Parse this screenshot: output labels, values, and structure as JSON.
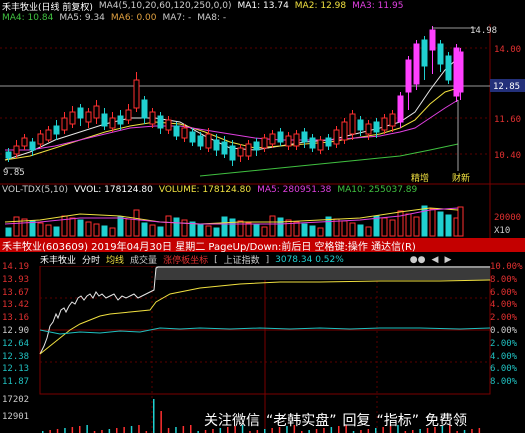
{
  "kline_header": {
    "stock_name": "禾丰牧业(日线 前复权)",
    "ma_params": "MA4(5,10,20,60,120,250,0,0)",
    "ma1": "MA1: 13.74",
    "ma2": "MA2: 12.98",
    "ma3": "MA3: 11.95",
    "ma4": "MA4: 10.84",
    "ma5": "MA5: 9.34",
    "ma6": "MA6: 0.00",
    "ma7": "MA7: -",
    "ma8": "MA8: -"
  },
  "kline_axis": {
    "high_label": "14.98",
    "p14_00": "14.00",
    "current": "12.85",
    "p11_60": "11.60",
    "p10_40": "10.40",
    "low_label": "9.85"
  },
  "kline_marks": {
    "surge": "精增",
    "news": "财新"
  },
  "vol_header": {
    "title": "VOL-TDX(5,10)",
    "vvol": "VVOL: 178124.80",
    "volume": "VOLUME: 178124.80",
    "ma5": "MA5: 280951.38",
    "ma10": "MA10: 255037.89"
  },
  "vol_axis": {
    "top": "20000",
    "unit": "X10"
  },
  "info_bar": {
    "text": "禾丰牧业(603609) 2019年04月30日 星期二 PageUp/Down:前后日 空格键:操作 通达信(R)"
  },
  "ts_header": {
    "name": "禾丰牧业",
    "tab_timeshare": "分时",
    "tab_avg": "均线",
    "tab_volume": "成交量",
    "tab_limit": "涨停板坐标",
    "index_name": "上证指数",
    "index_value": "3078.34 0.52%"
  },
  "ts_axis_left": [
    "14.19",
    "13.93",
    "13.67",
    "13.42",
    "13.16",
    "12.90",
    "12.64",
    "12.38",
    "12.13",
    "11.87"
  ],
  "ts_axis_right": [
    "10.00%",
    "8.00%",
    "6.00%",
    "4.00%",
    "2.00%",
    "0.00%",
    "2.00%",
    "4.00%",
    "6.00%",
    "8.00%"
  ],
  "ts_vol_axis": {
    "top": "17202",
    "mid": "12901"
  },
  "watermark": {
    "brand": "关注微信",
    "account": "“老韩实盘”",
    "reply": "回复",
    "keyword": "“指标”",
    "free": "免费领"
  },
  "colors": {
    "up": "#ff3030",
    "down": "#20d0d0",
    "magenta": "#ff40ff",
    "yellow": "#ffff40",
    "white": "#ffffff",
    "green": "#20c020",
    "grid": "#7a0000"
  }
}
